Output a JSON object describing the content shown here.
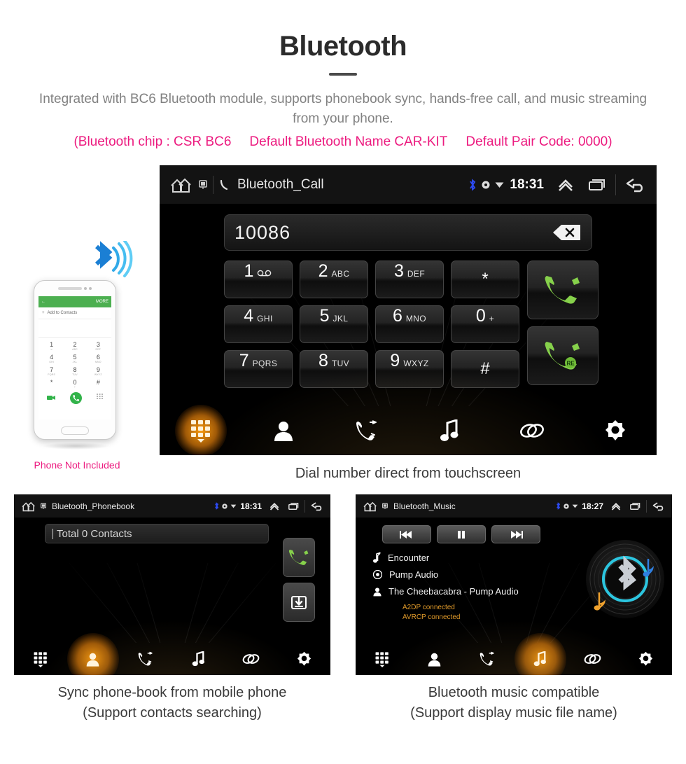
{
  "header": {
    "title": "Bluetooth",
    "subtitle": "Integrated with BC6 Bluetooth module, supports phonebook sync, hands-free call, and music streaming from your phone.",
    "spec_chip": "(Bluetooth chip : CSR BC6",
    "spec_name": "Default Bluetooth Name CAR-KIT",
    "spec_pair": "Default Pair Code: 0000)",
    "accent_pink": "#ec1a7f",
    "accent_orange": "#f79a10"
  },
  "phone_mock": {
    "not_included": "Phone Not Included",
    "appbar_back": "←",
    "appbar_more": "MORE",
    "add_contact": "Add to Contacts",
    "keys": [
      {
        "d": "1",
        "l": "∞"
      },
      {
        "d": "2",
        "l": "ABC"
      },
      {
        "d": "3",
        "l": "DEF"
      },
      {
        "d": "4",
        "l": "GHI"
      },
      {
        "d": "5",
        "l": "JKL"
      },
      {
        "d": "6",
        "l": "MNO"
      },
      {
        "d": "7",
        "l": "PQRS"
      },
      {
        "d": "8",
        "l": "TUV"
      },
      {
        "d": "9",
        "l": "WXYZ"
      },
      {
        "d": "*",
        "l": ""
      },
      {
        "d": "0",
        "l": "+"
      },
      {
        "d": "#",
        "l": ""
      }
    ]
  },
  "call_screen": {
    "status": {
      "title": "Bluetooth_Call",
      "time": "18:31",
      "icons": [
        "home-icon",
        "device-icon",
        "phone-icon",
        "bluetooth-icon",
        "signal-dot-icon",
        "wifi-icon",
        "chevron-up-icon",
        "recents-icon",
        "back-icon"
      ]
    },
    "number": "10086",
    "delete_icon": "backspace-icon",
    "keys": [
      {
        "d": "1",
        "l": "∞"
      },
      {
        "d": "2",
        "l": "ABC"
      },
      {
        "d": "3",
        "l": "DEF"
      },
      {
        "d": "*",
        "l": ""
      },
      {
        "d": "4",
        "l": "GHI"
      },
      {
        "d": "5",
        "l": "JKL"
      },
      {
        "d": "6",
        "l": "MNO"
      },
      {
        "d": "0",
        "l": "+"
      },
      {
        "d": "7",
        "l": "PQRS"
      },
      {
        "d": "8",
        "l": "TUV"
      },
      {
        "d": "9",
        "l": "WXYZ"
      },
      {
        "d": "#",
        "l": ""
      }
    ],
    "call_button": "call-icon",
    "redial_button": "redial-icon",
    "redial_badge": "RE",
    "caption": "Dial number direct from touchscreen"
  },
  "nav": {
    "items": [
      {
        "name": "keypad",
        "icon": "keypad-icon"
      },
      {
        "name": "contacts",
        "icon": "contact-icon"
      },
      {
        "name": "call-history",
        "icon": "call-history-icon"
      },
      {
        "name": "music",
        "icon": "music-note-icon"
      },
      {
        "name": "pair",
        "icon": "link-icon"
      },
      {
        "name": "settings",
        "icon": "gear-icon"
      }
    ],
    "active_call": 0,
    "active_phonebook": 1,
    "active_music": 3
  },
  "phonebook_screen": {
    "status": {
      "title": "Bluetooth_Phonebook",
      "time": "18:31"
    },
    "search_value": "Total 0 Contacts",
    "call_button": "call-icon",
    "download_button": "download-icon",
    "caption_line1": "Sync phone-book from mobile phone",
    "caption_line2": "(Support contacts searching)"
  },
  "music_screen": {
    "status": {
      "title": "Bluetooth_Music",
      "time": "18:27"
    },
    "controls": [
      {
        "name": "previous",
        "glyph": "⏮"
      },
      {
        "name": "pause",
        "glyph": "⏸"
      },
      {
        "name": "next",
        "glyph": "⏭"
      }
    ],
    "track_title": "Encounter",
    "track_album": "Pump Audio",
    "track_artist": "The Cheebacabra - Pump Audio",
    "status_a2dp": "A2DP connected",
    "status_avrcp": "AVRCP connected",
    "artwork": "vinyl-bluetooth-icon",
    "caption_line1": "Bluetooth music compatible",
    "caption_line2": "(Support display music file name)"
  }
}
